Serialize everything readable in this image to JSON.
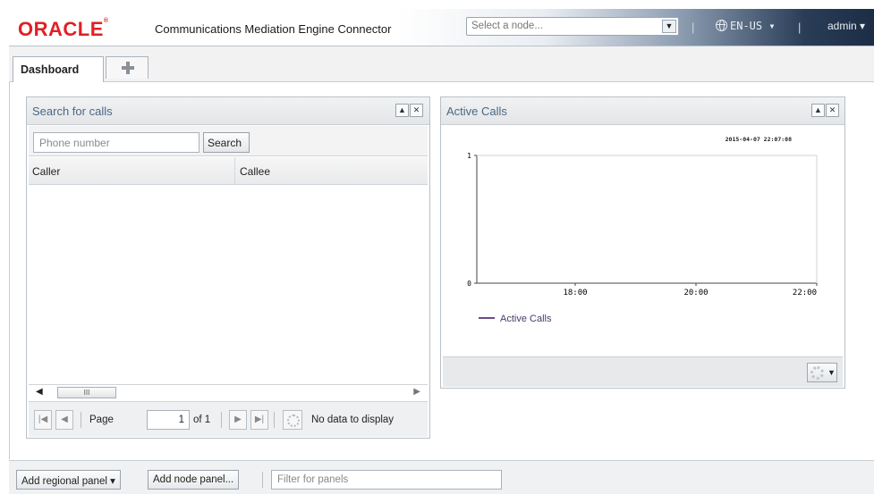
{
  "header": {
    "logo": "ORACLE",
    "app_title": "Communications Mediation Engine Connector",
    "node_select_placeholder": "Select a node...",
    "language": "EN-US",
    "user": "admin"
  },
  "tabs": [
    {
      "label": "Dashboard",
      "active": true
    }
  ],
  "search_panel": {
    "title": "Search for calls",
    "phone_placeholder": "Phone number",
    "search_label": "Search",
    "columns": [
      "Caller",
      "Callee"
    ],
    "rows": [],
    "scroll_thumb": "III",
    "pager": {
      "page_label": "Page",
      "page_value": "1",
      "of_label": "of 1",
      "status": "No data to display"
    }
  },
  "calls_panel": {
    "title": "Active Calls",
    "chart_data": {
      "type": "line",
      "timestamp": "2015-04-07 22:07:08",
      "x_ticks": [
        "18:00",
        "20:00",
        "22:00"
      ],
      "y_ticks": [
        "1",
        "0"
      ],
      "ylim": [
        0,
        1
      ],
      "grid": false,
      "legend_position": "bottom-left",
      "series": [
        {
          "name": "Active Calls",
          "color": "#6b4a8a",
          "values": []
        }
      ]
    }
  },
  "bottom_bar": {
    "add_regional_label": "Add regional panel",
    "add_node_label": "Add node panel...",
    "filter_placeholder": "Filter for panels"
  },
  "colors": {
    "brand_red": "#e21f26",
    "header_dark": "#1c2d45",
    "panel_title": "#4a6785"
  }
}
